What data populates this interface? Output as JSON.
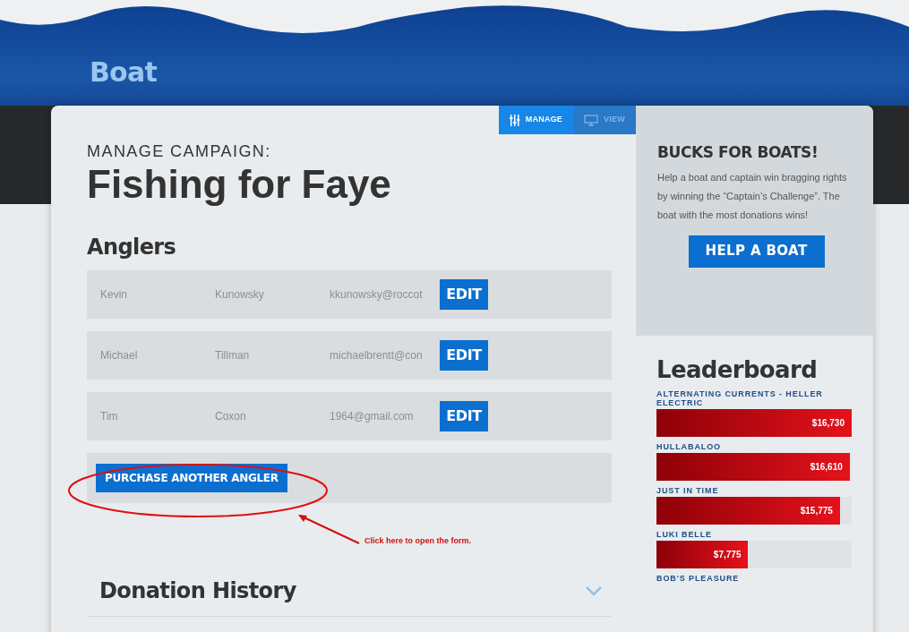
{
  "header": {
    "title": "Boat"
  },
  "tabs": [
    {
      "label": "MANAGE",
      "kind": "manage",
      "selected": true
    },
    {
      "label": "VIEW",
      "kind": "view",
      "selected": false
    }
  ],
  "campaign": {
    "eyebrow": "MANAGE CAMPAIGN:",
    "title": "Fishing for Faye"
  },
  "anglers": {
    "heading": "Anglers",
    "rows": [
      {
        "first": "Kevin",
        "last": "Kunowsky",
        "email": "kkunowsky@roccot",
        "action": "EDIT"
      },
      {
        "first": "Michael",
        "last": "Tillman",
        "email": "michaelbrentt@con",
        "action": "EDIT"
      },
      {
        "first": "Tim",
        "last": "Coxon",
        "email": "1964@gmail.com",
        "action": "EDIT"
      }
    ],
    "purchase_button": "PURCHASE ANOTHER ANGLER"
  },
  "annotation": {
    "text": "Click here to open the form."
  },
  "donation_history": {
    "heading": "Donation History",
    "expanded": false
  },
  "promo": {
    "title": "BUCKS FOR BOATS!",
    "body": "Help a boat and captain win bragging rights by winning the “Captain’s Challenge”. The boat with the most donations wins!",
    "button": "HELP A BOAT"
  },
  "leaderboard": {
    "heading": "Leaderboard",
    "entries": [
      {
        "name": "ALTERNATING CURRENTS - HELLER ELECTRIC",
        "amount": "$16,730",
        "level": 1.0
      },
      {
        "name": "HULLABALOO",
        "amount": "$16,610",
        "level": 0.99
      },
      {
        "name": "JUST IN TIME",
        "amount": "$15,775",
        "level": 0.94
      },
      {
        "name": "LUKI BELLE",
        "amount": "$7,775",
        "level": 0.47
      },
      {
        "name": "BOB'S PLEASURE"
      }
    ]
  }
}
